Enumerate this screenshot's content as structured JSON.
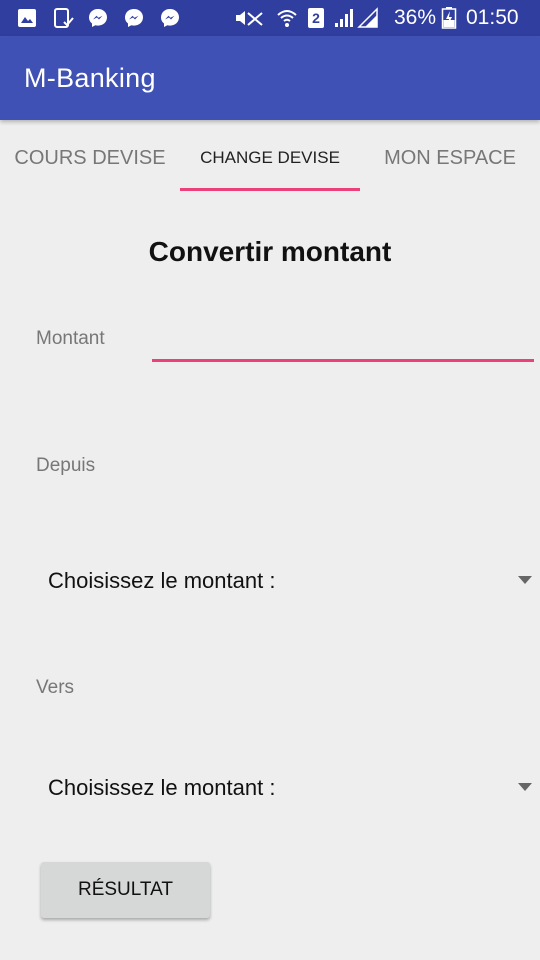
{
  "status_bar": {
    "icons": [
      "gallery-icon",
      "tablet-check-icon",
      "messenger-icon",
      "messenger-icon",
      "messenger-icon",
      "mute-icon",
      "wifi-icon",
      "sim-2-icon",
      "signal-icon",
      "signal-icon",
      "battery-charging-icon"
    ],
    "battery": "36%",
    "time": "01:50"
  },
  "app_bar": {
    "title": "M-Banking",
    "color": "#3f51b5",
    "status_color": "#303f9f"
  },
  "tabs": {
    "items": [
      {
        "label": "COURS DEVISE"
      },
      {
        "label": "CHANGE DEVISE"
      },
      {
        "label": "MON ESPACE"
      }
    ],
    "active_index": 1,
    "indicator_color": "#ec407a"
  },
  "form": {
    "title": "Convertir montant",
    "amount_label": "Montant",
    "amount_value": "",
    "from_label": "Depuis",
    "from_spinner": "Choisissez le montant :",
    "to_label": "Vers",
    "to_spinner": "Choisissez le montant :",
    "result_button": "RÉSULTAT"
  }
}
